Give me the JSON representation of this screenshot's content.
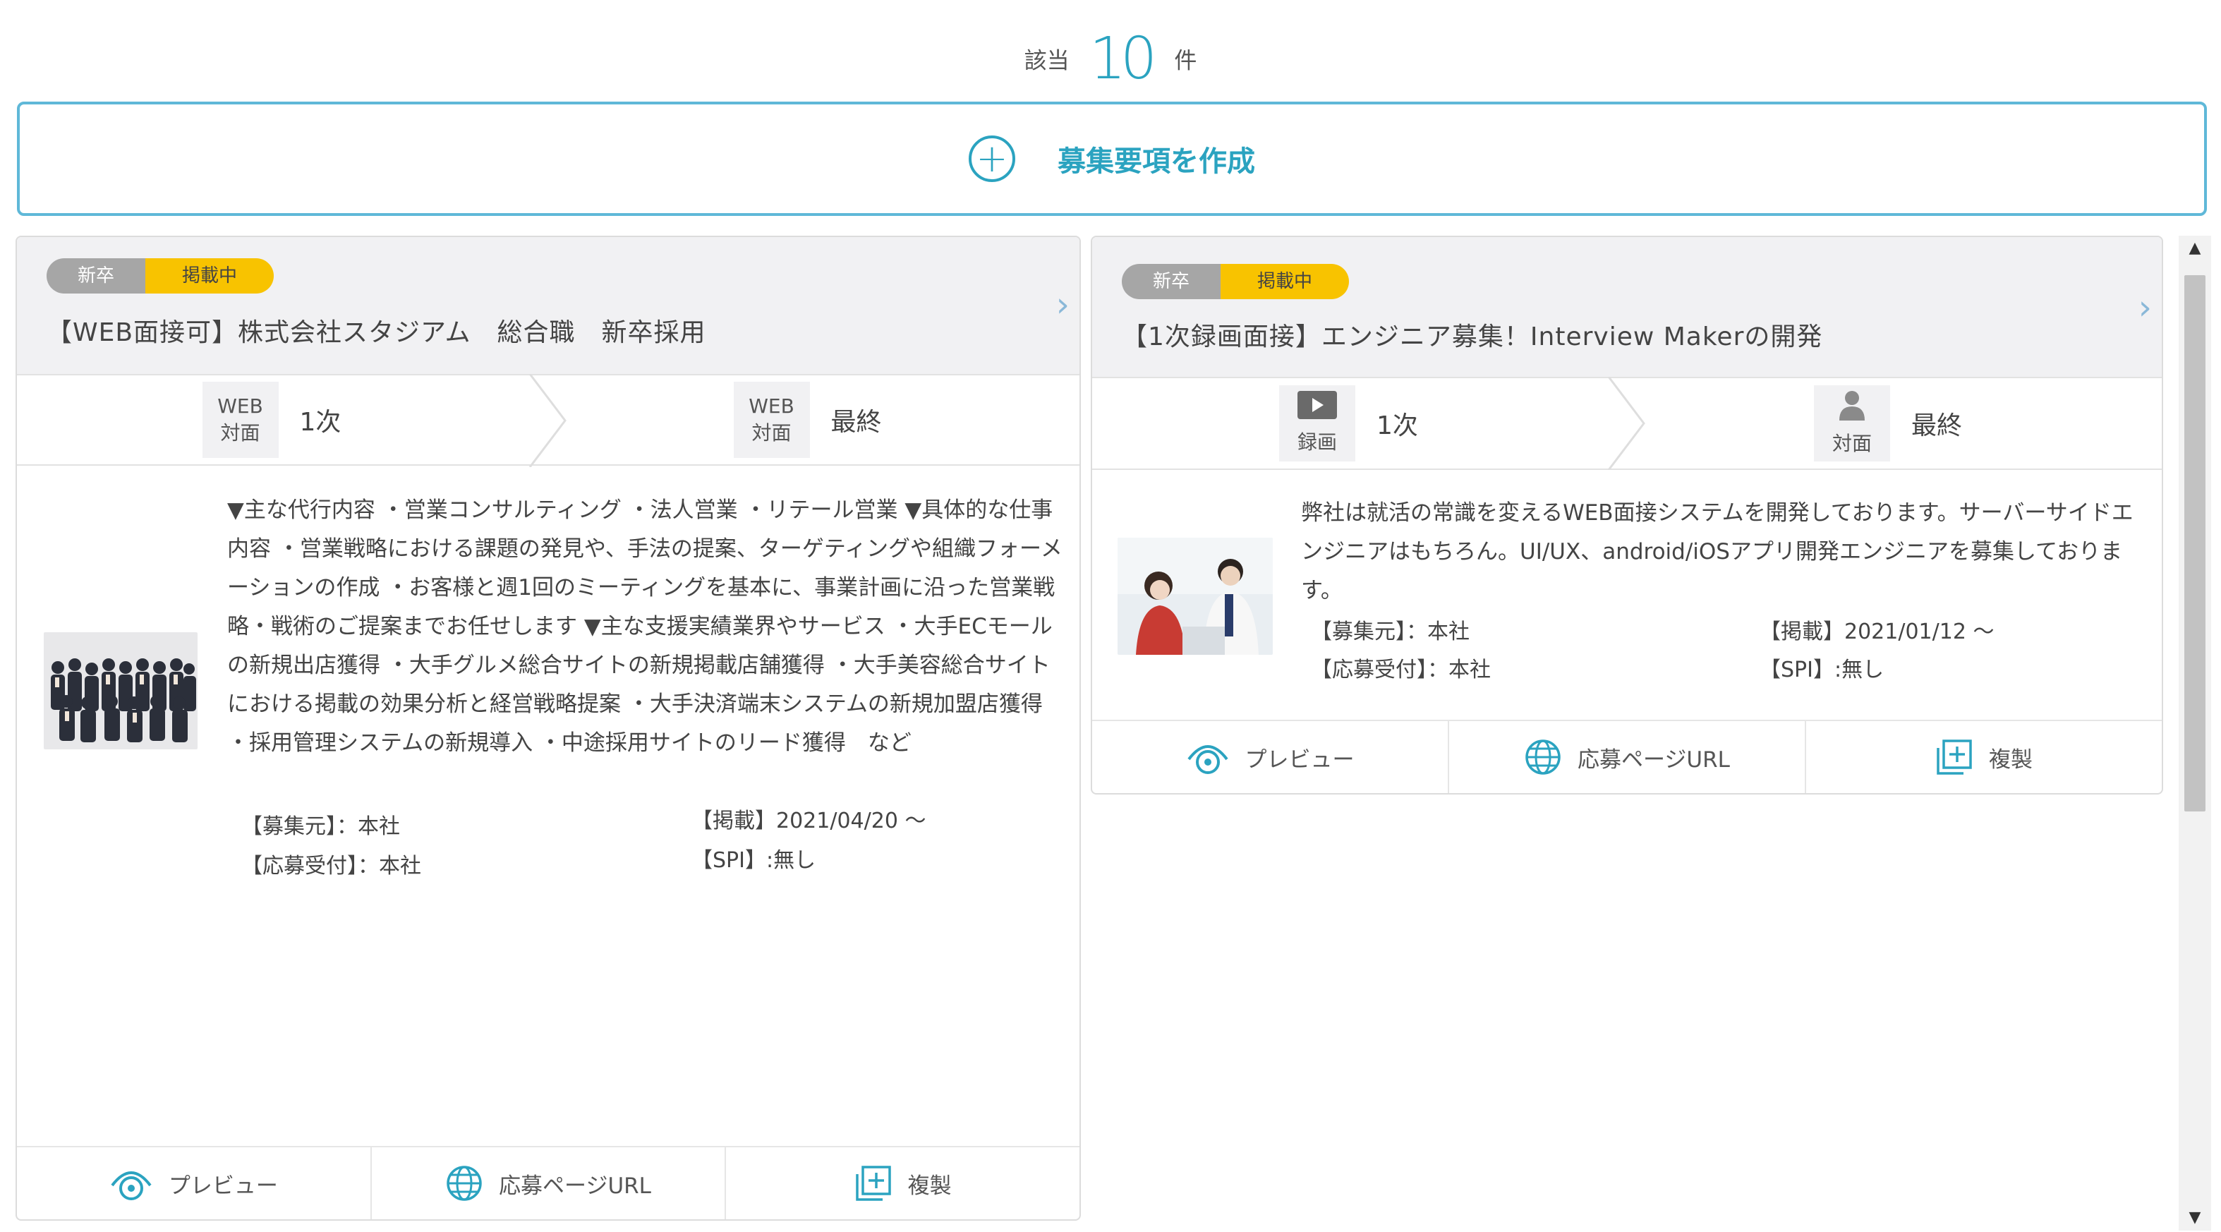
{
  "summary": {
    "prefix": "該当",
    "count": "10",
    "suffix": "件"
  },
  "create_button": {
    "label": "募集要項を作成"
  },
  "cards": [
    {
      "badge_type": "新卒",
      "badge_status": "掲載中",
      "title": "【WEB面接可】株式会社スタジアム　総合職　新卒採用",
      "steps": [
        {
          "type_line1": "WEB",
          "type_line2": "対面",
          "label": "1次"
        },
        {
          "type_line1": "WEB",
          "type_line2": "対面",
          "label": "最終"
        }
      ],
      "description": "▼主な代行内容 ・営業コンサルティング ・法人営業 ・リテール営業 ▼具体的な仕事内容 ・営業戦略における課題の発見や、手法の提案、ターゲティングや組織フォーメーションの作成 ・お客様と週1回のミーティングを基本に、事業計画に沿った営業戦略・戦術のご提案までお任せします ▼主な支援実績業界やサービス ・大手ECモールの新規出店獲得 ・大手グルメ総合サイトの新規掲載店舗獲得 ・大手美容総合サイトにおける掲載の効果分析と経営戦略提案 ・大手決済端末システムの新規加盟店獲得 ・採用管理システムの新規導入 ・中途採用サイトのリード獲得　など",
      "recruiter": "【募集元】：本社",
      "application": "【応募受付】：本社",
      "published": "【掲載】2021/04/20 ～",
      "spi": "【SPI】:無し",
      "actions": {
        "preview": "プレビュー",
        "url": "応募ページURL",
        "duplicate": "複製"
      }
    },
    {
      "badge_type": "新卒",
      "badge_status": "掲載中",
      "title": "【1次録画面接】エンジニア募集！Interview Makerの開発",
      "steps": [
        {
          "type_line1": "録画",
          "label": "1次",
          "icon": "video-icon"
        },
        {
          "type_line1": "対面",
          "label": "最終",
          "icon": "person-icon"
        }
      ],
      "description": "弊社は就活の常識を変えるWEB面接システムを開発しております。サーバーサイドエンジニアはもちろん。UI/UX、android/iOSアプリ開発エンジニアを募集しております。",
      "recruiter": "【募集元】：本社",
      "application": "【応募受付】：本社",
      "published": "【掲載】2021/01/12 ～",
      "spi": "【SPI】:無し",
      "actions": {
        "preview": "プレビュー",
        "url": "応募ページURL",
        "duplicate": "複製"
      }
    }
  ],
  "colors": {
    "accent": "#2ba3c0",
    "status_badge": "#f8c300",
    "type_badge": "#a6a6a6"
  }
}
